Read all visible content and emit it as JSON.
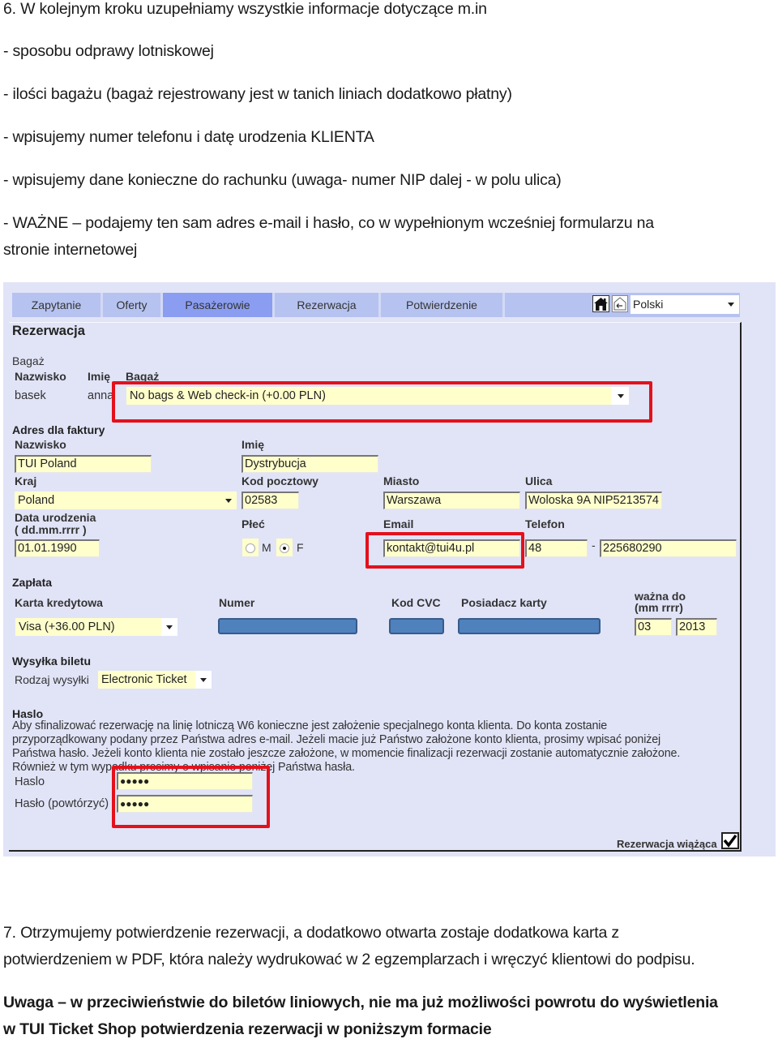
{
  "intro": {
    "heading": "6. W kolejnym kroku uzupełniamy wszystkie informacje dotyczące m.in",
    "bullets": [
      "- sposobu odprawy lotniskowej",
      "- ilości bagażu (bagaż rejestrowany jest w tanich liniach dodatkowo płatny)",
      "- wpisujemy numer telefonu i datę urodzenia KLIENTA",
      "- wpisujemy dane konieczne do rachunku (uwaga- numer NIP  dalej  - w polu ulica)",
      "- WAŻNE – podajemy ten sam adres e-mail i hasło, co w wypełnionym wcześniej formularzu na",
      "stronie internetowej"
    ]
  },
  "screenshot": {
    "tabs": [
      {
        "label": "Zapytanie",
        "active": false
      },
      {
        "label": "Oferty",
        "active": false
      },
      {
        "label": "Pasażerowie",
        "active": true
      },
      {
        "label": "Rezerwacja",
        "active": false
      },
      {
        "label": "Potwierdzenie",
        "active": false
      }
    ],
    "icons": {
      "home": "home-icon",
      "back": "back-icon"
    },
    "language": {
      "selected": "Polski"
    },
    "page_title": "Rezerwacja",
    "baggage": {
      "section": "Bagaż",
      "columns": [
        "Nazwisko",
        "Imię",
        "Bagaż"
      ],
      "row": {
        "surname": "basek",
        "name": "anna",
        "baggage": "No bags & Web check-in (+0.00 PLN)"
      }
    },
    "invoice": {
      "section": "Adres dla faktury",
      "surname_label": "Nazwisko",
      "surname": "TUI Poland",
      "name_label": "Imię",
      "name": "Dystrybucja",
      "country_label": "Kraj",
      "country": "Poland",
      "postcode_label": "Kod pocztowy",
      "postcode": "02583",
      "city_label": "Miasto",
      "city": "Warszawa",
      "street_label": "Ulica",
      "street": "Woloska 9A NIP5213574",
      "birth_label_1": "Data urodzenia",
      "birth_label_2": "( dd.mm.rrrr )",
      "birth": "01.01.1990",
      "gender_label": "Płeć",
      "gender_options": [
        "M",
        "F"
      ],
      "gender_selected": "F",
      "email_label": "Email",
      "email": "kontakt@tui4u.pl",
      "phone_label": "Telefon",
      "phone_prefix": "48",
      "phone_sep": "-",
      "phone": "225680290"
    },
    "payment": {
      "section": "Zapłata",
      "card_label": "Karta kredytowa",
      "card": "Visa (+36.00 PLN)",
      "number_label": "Numer",
      "cvc_label": "Kod CVC",
      "holder_label": "Posiadacz karty",
      "valid_label_1": "ważna do",
      "valid_label_2": "(mm rrrr)",
      "valid_month": "03",
      "valid_year": "2013"
    },
    "shipping": {
      "section": "Wysyłka biletu",
      "type_label": "Rodzaj wysyłki",
      "type": "Electronic Ticket"
    },
    "password": {
      "section": "Haslo",
      "info_lines": [
        "Aby sfinalizować rezerwację na linię lotniczą W6 konieczne jest założenie specjalnego konta klienta. Do konta zostanie",
        "przyporządkowany podany przez Państwa adres e-mail. Jeżeli macie już Państwo założone konto klienta, prosimy wpisać poniżej",
        "Państwa hasło. Jeżeli konto klienta nie zostało jeszcze założone, w momencie finalizacji rezerwacji zostanie automatycznie założone.",
        "Również w tym wypadku prosimy o wpisanie poniżej Państwa hasła."
      ],
      "password_label": "Haslo",
      "password_value": "●●●●●",
      "repeat_label": "Hasło (powtórzyć)",
      "repeat_value": "●●●●●"
    },
    "binding": {
      "label": "Rezerwacja wiążąca",
      "checked": true
    },
    "highlight_color": "#e3111c"
  },
  "outro": {
    "step7_line1": "7. Otrzymujemy potwierdzenie rezerwacji, a dodatkowo otwarta zostaje dodatkowa karta z",
    "step7_line2": "potwierdzeniem w PDF, która należy wydrukować w 2 egzemplarzach i wręczyć klientowi do podpisu.",
    "note_line1": "Uwaga – w przeciwieństwie do biletów  liniowych, nie ma już możliwości powrotu do wyświetlenia",
    "note_line2": "w TUI Ticket Shop potwierdzenia rezerwacji w poniższym formacie"
  }
}
